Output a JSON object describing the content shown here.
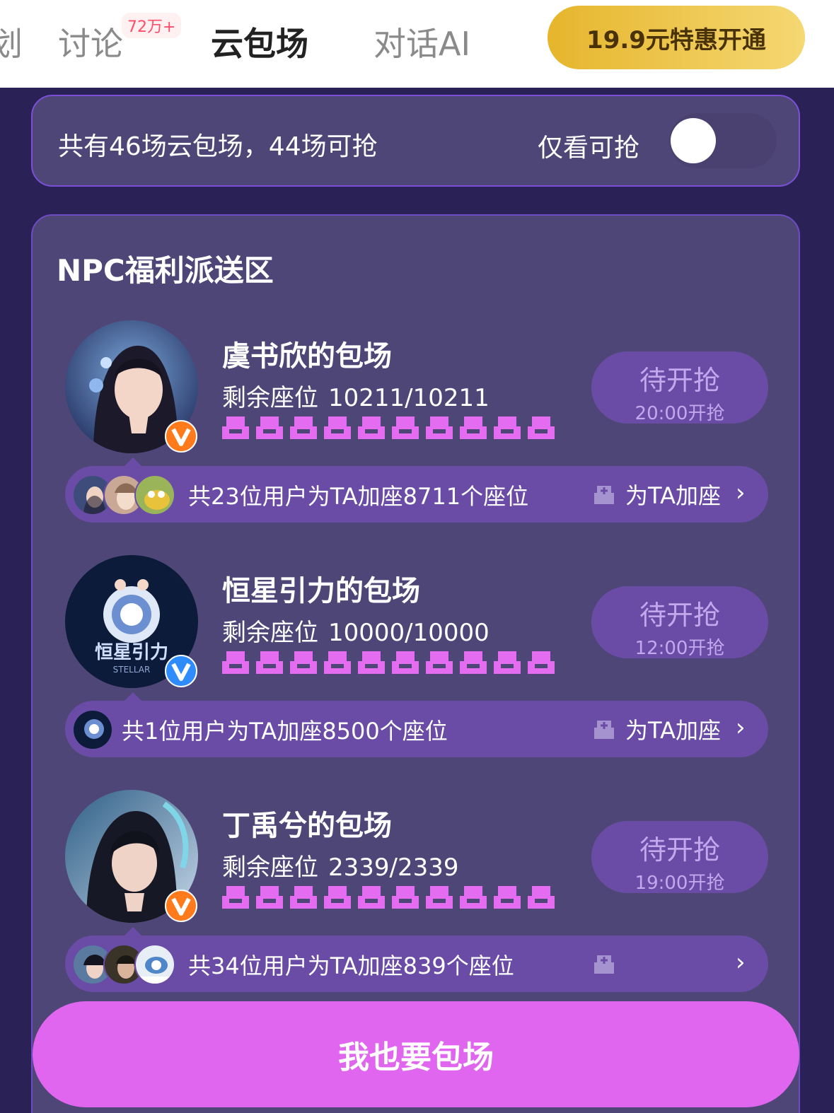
{
  "tabs": [
    {
      "label": "划"
    },
    {
      "label": "讨论",
      "badge": "72万+"
    },
    {
      "label": "云包场",
      "active": true
    },
    {
      "label": "对话AI"
    }
  ],
  "promo_button": "19.9元特惠开通",
  "summary": {
    "text": "共有46场云包场，44场可抢",
    "filter_label": "仅看可抢",
    "filter_on": false
  },
  "zone_title": "NPC福利派送区",
  "entries": [
    {
      "name": "虞书欣的包场",
      "seat_label": "剩余座位",
      "seat_value": "10211/10211",
      "status": "待开抢",
      "start_time": "20:00开抢",
      "supporters_text": "共23位用户为TA加座8711个座位",
      "add_seat_label": "为TA加座"
    },
    {
      "name": "恒星引力的包场",
      "seat_label": "剩余座位",
      "seat_value": "10000/10000",
      "status": "待开抢",
      "start_time": "12:00开抢",
      "supporters_text": "共1位用户为TA加座8500个座位",
      "add_seat_label": "为TA加座"
    },
    {
      "name": "丁禹兮的包场",
      "seat_label": "剩余座位",
      "seat_value": "2339/2339",
      "status": "待开抢",
      "start_time": "19:00开抢",
      "supporters_text": "共34位用户为TA加座839个座位",
      "add_seat_label": ""
    }
  ],
  "cta_label": "我也要包场",
  "colors": {
    "page_bg": "#2a2257",
    "card_bg": "#4f4678",
    "button_bg": "#6a4ca7",
    "seat_icon": "#e46cf0",
    "cta": "#e066ef",
    "promo": "#e6b52c",
    "vip_badge": "#ff7a1a"
  }
}
